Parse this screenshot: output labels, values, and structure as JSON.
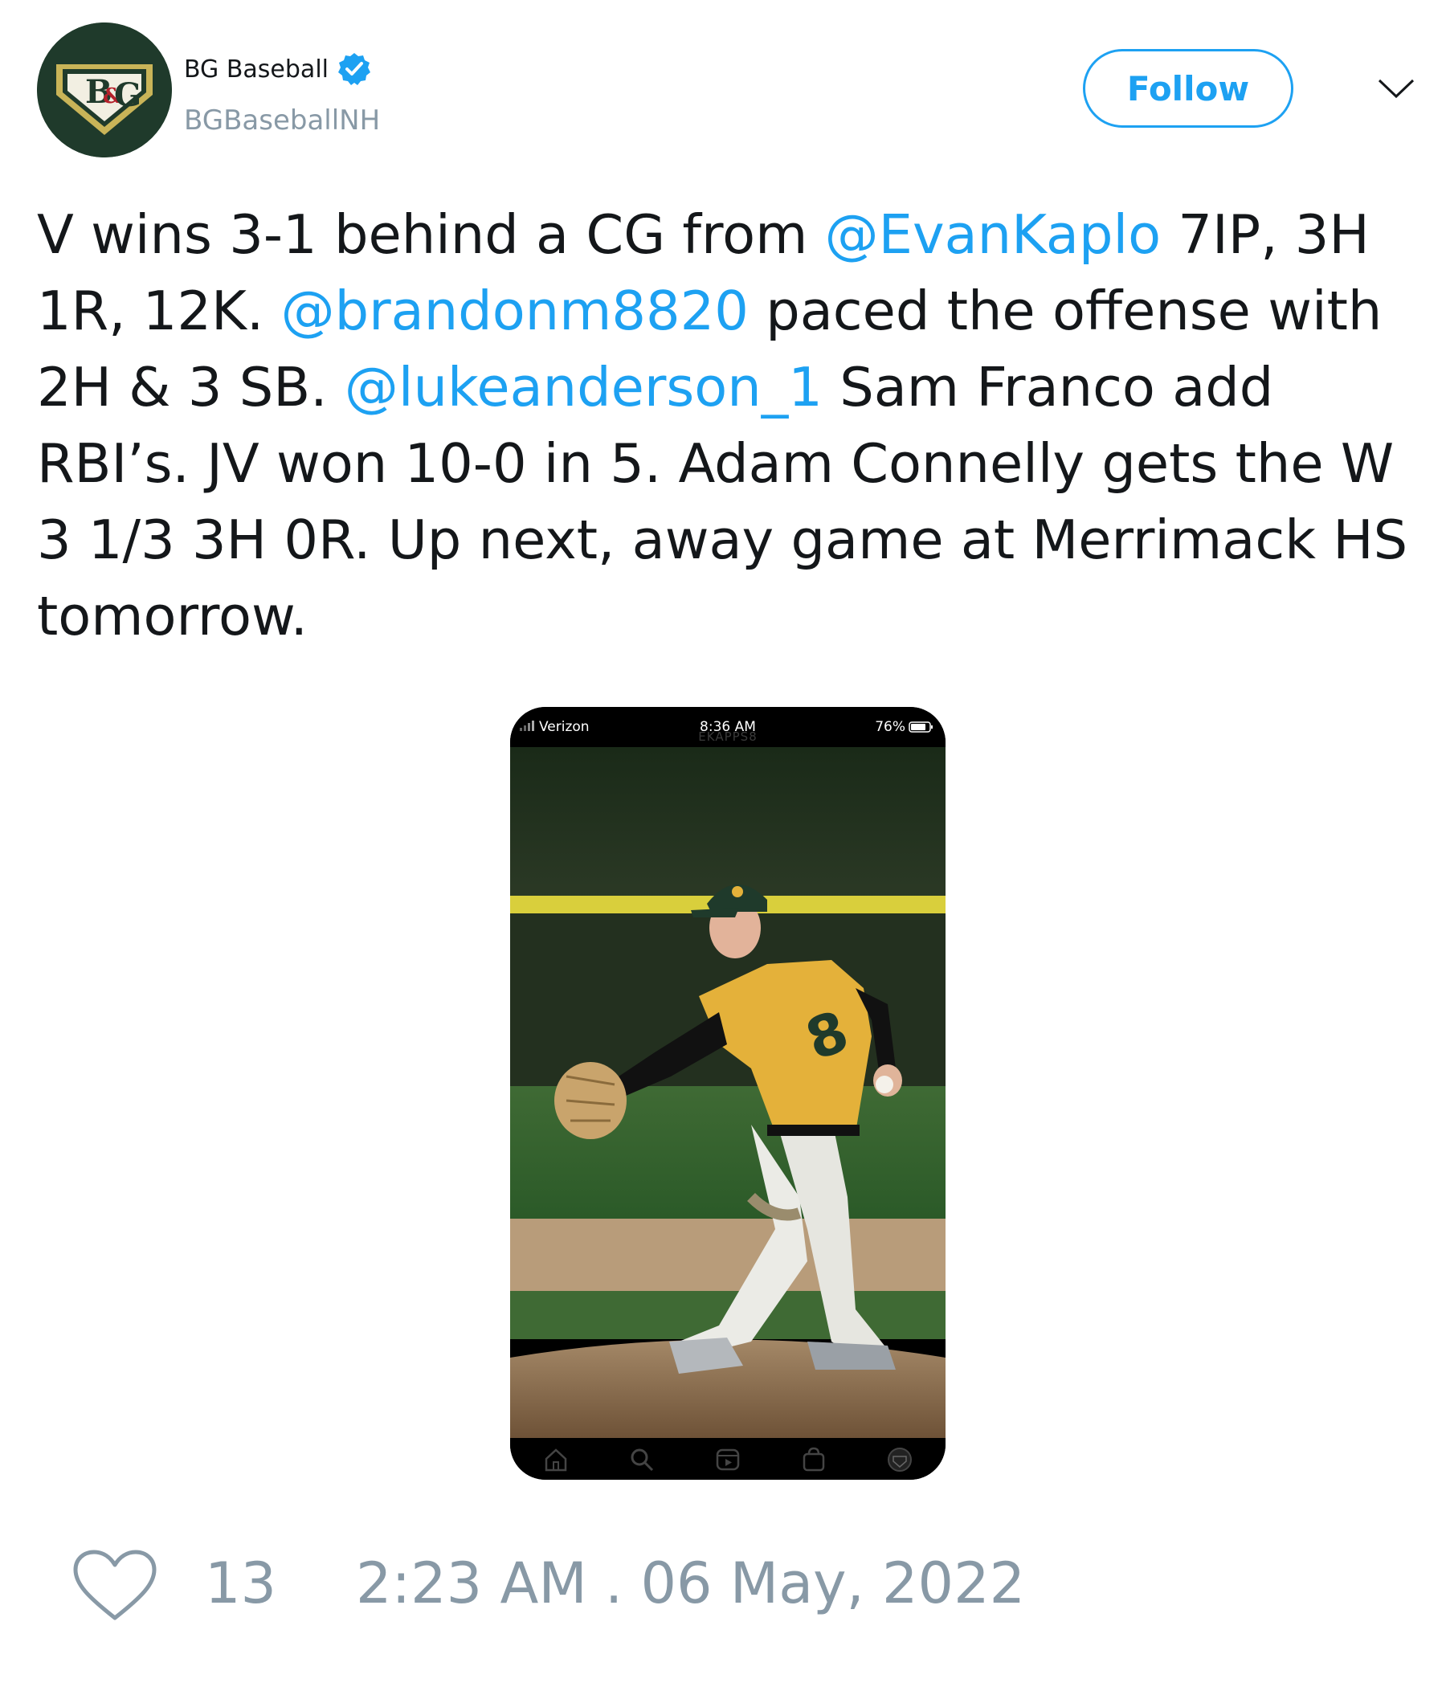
{
  "author": {
    "display_name": "BG Baseball",
    "handle": "BGBaseballNH",
    "verified": true,
    "avatar_icon": "bg-logo-icon"
  },
  "actions": {
    "follow_label": "Follow",
    "menu_icon": "chevron-down-icon"
  },
  "tweet": {
    "segments": [
      {
        "text": "V wins 3-1 behind a CG from ",
        "mention": false
      },
      {
        "text": "@EvanKaplo",
        "mention": true
      },
      {
        "text": " 7IP, 3H 1R, 12K. ",
        "mention": false
      },
      {
        "text": "@brandonm8820",
        "mention": true
      },
      {
        "text": " paced the offense with 2H & 3 SB. ",
        "mention": false
      },
      {
        "text": "@lukeanderson_1",
        "mention": true
      },
      {
        "text": " Sam Franco add RBI’s. JV won 10-0 in 5. Adam Connelly gets the W 3 1/3 3H 0R. Up next, away game at Merrimack HS tomorrow.",
        "mention": false
      }
    ]
  },
  "media": {
    "status_bar": {
      "carrier": "Verizon",
      "time": "8:36 AM",
      "battery": "76%"
    },
    "app_header": "EKAPPS8",
    "player_number": "8",
    "tab_icons": [
      "home-icon",
      "search-icon",
      "reels-icon",
      "shop-icon",
      "profile-icon"
    ]
  },
  "footer": {
    "like_count": "13",
    "timestamp": "2:23 AM . 06 May, 2022"
  },
  "colors": {
    "accent": "#1da1f2",
    "muted": "#8899a6",
    "text": "#14171a"
  }
}
